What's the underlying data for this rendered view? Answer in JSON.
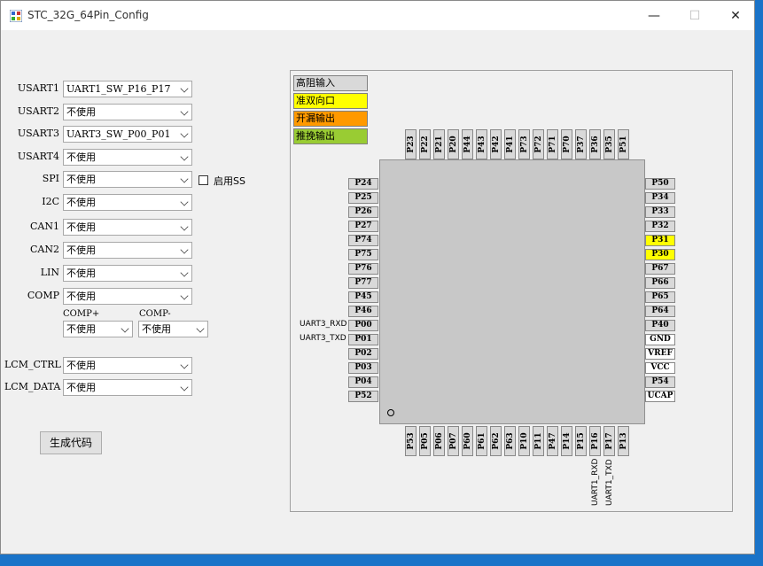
{
  "window": {
    "title": "STC_32G_64Pin_Config",
    "minimize": "—",
    "maximize": "☐",
    "close": "✕"
  },
  "fields": [
    {
      "label": "USART1",
      "value": "UART1_SW_P16_P17"
    },
    {
      "label": "USART2",
      "value": "不使用"
    },
    {
      "label": "USART3",
      "value": "UART3_SW_P00_P01"
    },
    {
      "label": "USART4",
      "value": "不使用"
    },
    {
      "label": "SPI",
      "value": "不使用"
    },
    {
      "label": "I2C",
      "value": "不使用"
    },
    {
      "label": "CAN1",
      "value": "不使用"
    },
    {
      "label": "CAN2",
      "value": "不使用"
    },
    {
      "label": "LIN",
      "value": "不使用"
    },
    {
      "label": "COMP",
      "value": "不使用"
    }
  ],
  "spi_ss": {
    "label": "启用SS",
    "checked": false
  },
  "comp_plus": {
    "label": "COMP+",
    "value": "不使用"
  },
  "comp_minus": {
    "label": "COMP-",
    "value": "不使用"
  },
  "lcm_ctrl": {
    "label": "LCM_CTRL",
    "value": "不使用"
  },
  "lcm_data": {
    "label": "LCM_DATA",
    "value": "不使用"
  },
  "generate_button": "生成代码",
  "legend": [
    {
      "label": "高阻输入",
      "color": "#d9d9d9"
    },
    {
      "label": "准双向口",
      "color": "#ffff00"
    },
    {
      "label": "开漏输出",
      "color": "#ff9900"
    },
    {
      "label": "推挽输出",
      "color": "#99cc33"
    }
  ],
  "pins_top": [
    "P23",
    "P22",
    "P21",
    "P20",
    "P44",
    "P43",
    "P42",
    "P41",
    "P73",
    "P72",
    "P71",
    "P70",
    "P37",
    "P36",
    "P35",
    "P51"
  ],
  "pins_left": [
    "P24",
    "P25",
    "P26",
    "P27",
    "P74",
    "P75",
    "P76",
    "P77",
    "P45",
    "P46",
    "P00",
    "P01",
    "P02",
    "P03",
    "P04",
    "P52"
  ],
  "pins_right": [
    "P50",
    "P34",
    "P33",
    "P32",
    "P31",
    "P30",
    "P67",
    "P66",
    "P65",
    "P64",
    "P40",
    "GND",
    "VREF",
    "VCC",
    "P54",
    "UCAP"
  ],
  "pins_bottom": [
    "P53",
    "P05",
    "P06",
    "P07",
    "P60",
    "P61",
    "P62",
    "P63",
    "P10",
    "P11",
    "P47",
    "P14",
    "P15",
    "P16",
    "P17",
    "P13"
  ],
  "right_pin_colors": [
    "#d9d9d9",
    "#d9d9d9",
    "#d9d9d9",
    "#d9d9d9",
    "#ffff00",
    "#ffff00",
    "#d9d9d9",
    "#d9d9d9",
    "#d9d9d9",
    "#d9d9d9",
    "#d9d9d9",
    "#ffffff",
    "#ffffff",
    "#ffffff",
    "#d9d9d9",
    "#ffffff"
  ],
  "pin_functions": {
    "P00": "UART3_RXD",
    "P01": "UART3_TXD",
    "P16": "UART1_RXD",
    "P17": "UART1_TXD"
  }
}
